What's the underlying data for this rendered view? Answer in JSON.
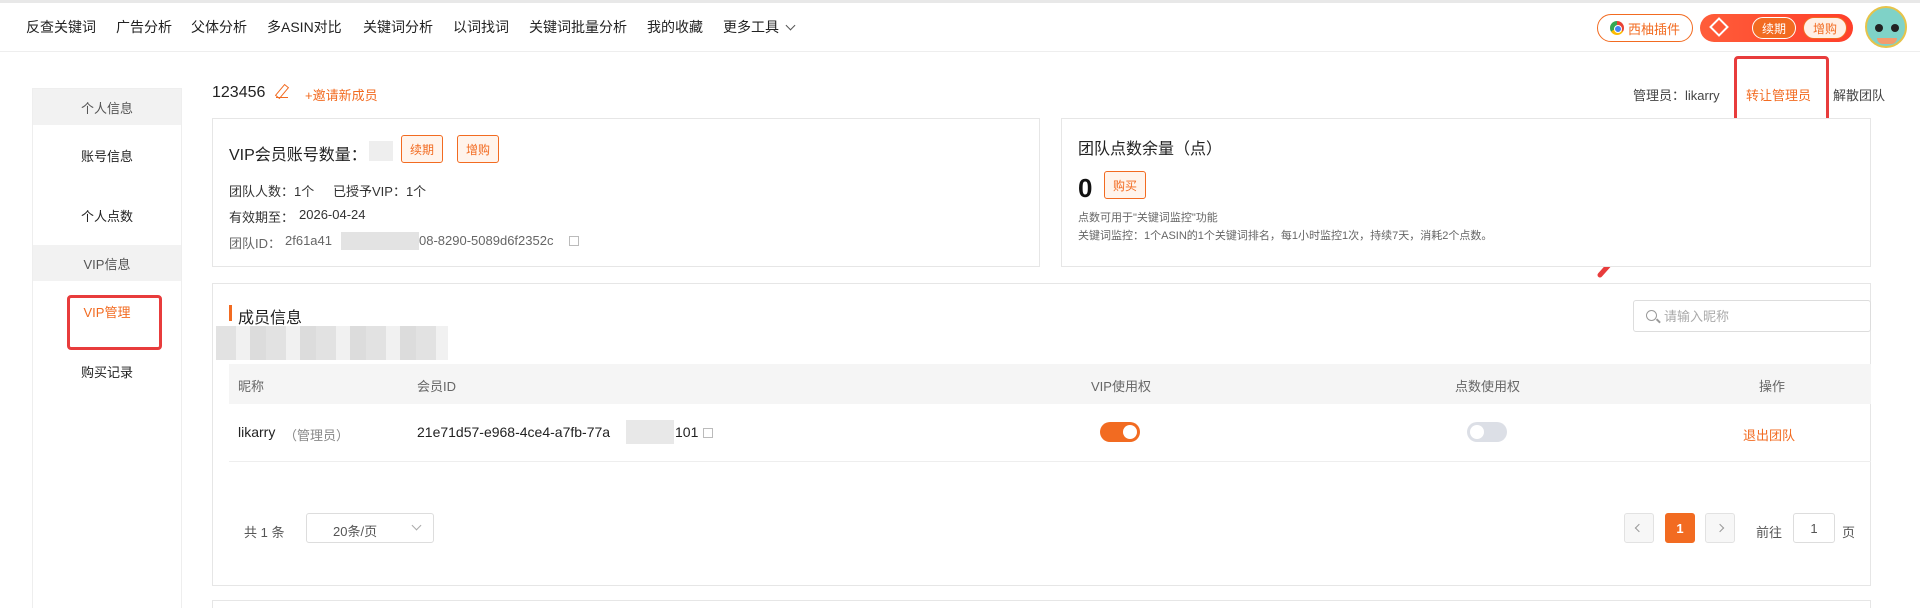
{
  "nav": {
    "items": [
      "反查关键词",
      "广告分析",
      "父体分析",
      "多ASIN对比",
      "关键词分析",
      "以词找词",
      "关键词批量分析",
      "我的收藏",
      "更多工具"
    ],
    "plugin_label": "西柚插件",
    "renew_label": "续期",
    "buy_label": "增购"
  },
  "sidebar": {
    "group_personal": "个人信息",
    "item_account": "账号信息",
    "item_points": "个人点数",
    "group_vip": "VIP信息",
    "item_vip_manage": "VIP管理",
    "item_purchase": "购买记录"
  },
  "header": {
    "team_name": "123456",
    "invite": "+邀请新成员",
    "admin_label": "管理员：likarry",
    "transfer_admin": "转让管理员",
    "dissolve": "解散团队"
  },
  "vip_card": {
    "title": "VIP会员账号数量：",
    "renew": "续期",
    "buy": "增购",
    "team_count": "团队人数：1个",
    "vip_granted": "已授予VIP：1个",
    "valid_until": "有效期至：",
    "valid_date": "2026-04-24",
    "team_id_label": "团队ID：",
    "team_id_start": "2f61a41",
    "team_id_end": "08-8290-5089d6f2352c"
  },
  "points_card": {
    "title": "团队点数余量（点）",
    "value": "0",
    "buy": "购买",
    "note1": "点数可用于\"关键词监控\"功能",
    "note2": "关键词监控：1个ASIN的1个关键词排名，每1小时监控1次，持续7天，消耗2个点数。"
  },
  "members": {
    "title": "成员信息",
    "search_placeholder": "请输入昵称",
    "columns": [
      "昵称",
      "会员ID",
      "VIP使用权",
      "点数使用权",
      "操作"
    ],
    "rows": [
      {
        "nickname": "likarry",
        "role": "（管理员）",
        "id_start": "21e71d57-e968-4ce4-a7fb-77a",
        "id_end": "101",
        "vip_on": true,
        "points_on": false,
        "action": "退出团队"
      }
    ]
  },
  "pagination": {
    "total": "共 1 条",
    "page_size": "20条/页",
    "current": "1",
    "goto_label": "前往",
    "goto_value": "1",
    "page_suffix": "页"
  },
  "colors": {
    "accent": "#f26b21",
    "highlight": "#e83c3c"
  }
}
